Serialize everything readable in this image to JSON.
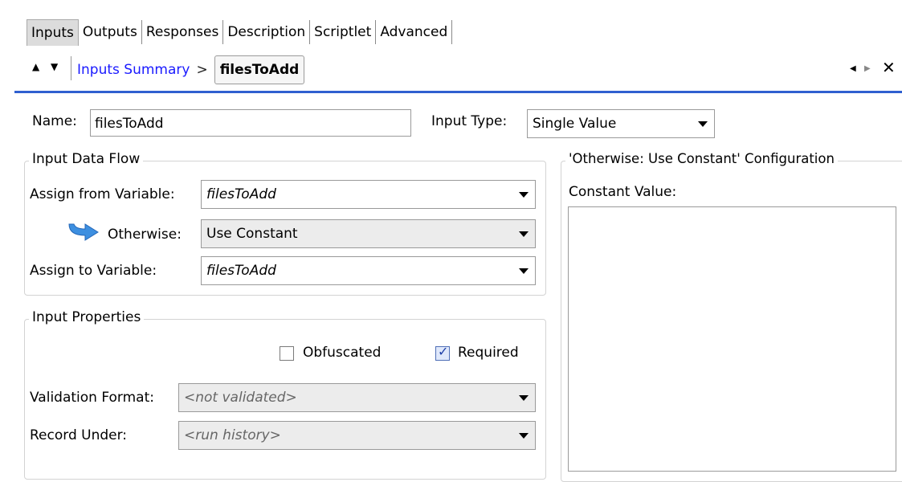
{
  "tabs": [
    {
      "label": "Inputs",
      "active": true
    },
    {
      "label": "Outputs",
      "active": false
    },
    {
      "label": "Responses",
      "active": false
    },
    {
      "label": "Description",
      "active": false
    },
    {
      "label": "Scriptlet",
      "active": false
    },
    {
      "label": "Advanced",
      "active": false
    }
  ],
  "breadcrumb": {
    "up_icon": "triangle-up-icon",
    "down_icon": "triangle-down-icon",
    "link": "Inputs Summary",
    "separator": ">",
    "current": "filesToAdd"
  },
  "window_controls": {
    "prev_icon": "triangle-left-icon",
    "next_icon": "triangle-right-icon",
    "close_icon": "close-icon",
    "close_glyph": "✕"
  },
  "form": {
    "name_label": "Name:",
    "name_value": "filesToAdd",
    "input_type_label": "Input Type:",
    "input_type_value": "Single Value"
  },
  "data_flow": {
    "title": "Input Data Flow",
    "assign_from_label": "Assign from Variable:",
    "assign_from_value": "filesToAdd",
    "otherwise_label": "Otherwise:",
    "otherwise_value": "Use Constant",
    "otherwise_icon": "curved-arrow-icon",
    "assign_to_label": "Assign to Variable:",
    "assign_to_value": "filesToAdd"
  },
  "properties": {
    "title": "Input Properties",
    "obfuscated_label": "Obfuscated",
    "obfuscated_checked": false,
    "required_label": "Required",
    "required_checked": true,
    "validation_label": "Validation Format:",
    "validation_value": "<not validated>",
    "record_label": "Record Under:",
    "record_value": "<run history>"
  },
  "constant_config": {
    "title": "'Otherwise: Use Constant' Configuration",
    "constant_label": "Constant Value:",
    "constant_value": ""
  },
  "colors": {
    "accent_line": "#2f5fd0",
    "link": "#1a1aff",
    "arrow_icon": "#3d8fe0"
  }
}
